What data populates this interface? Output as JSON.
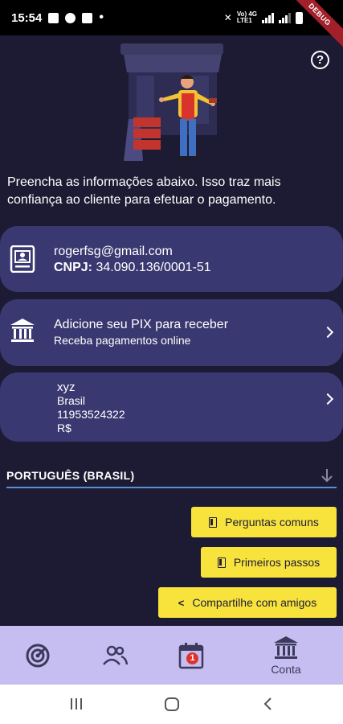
{
  "status_bar": {
    "time": "15:54",
    "debug_label": "DEBUG",
    "net_top": "Vo) 4G",
    "net_bottom": "LTE1"
  },
  "help": {
    "label": "?"
  },
  "intro": {
    "text": "Preencha as informações abaixo. Isso traz mais confiança ao cliente para efetuar o pagamento."
  },
  "profile": {
    "email": "rogerfsg@gmail.com",
    "cnpj_label": "CNPJ:",
    "cnpj_value": " 34.090.136/0001-51"
  },
  "pix": {
    "title": "Adicione seu PIX para receber",
    "subtitle": "Receba pagamentos online"
  },
  "address": {
    "line1": "xyz",
    "line2": "Brasil",
    "line3": "11953524322",
    "line4": "R$"
  },
  "language": {
    "selected": "PORTUGUÊS (BRASIL)"
  },
  "buttons": {
    "faq": "Perguntas comuns",
    "first_steps": "Primeiros passos",
    "share": "Compartilhe com amigos"
  },
  "bottom_nav": {
    "items": [
      {
        "icon": "dashboard-icon",
        "label": ""
      },
      {
        "icon": "people-icon",
        "label": ""
      },
      {
        "icon": "calendar-icon",
        "label": "",
        "badge": "1"
      },
      {
        "icon": "bank-icon",
        "label": "Conta"
      }
    ]
  },
  "colors": {
    "background": "#1c1b33",
    "card": "#3a3870",
    "accent": "#f7e33b",
    "nav": "#c6bdf0"
  }
}
